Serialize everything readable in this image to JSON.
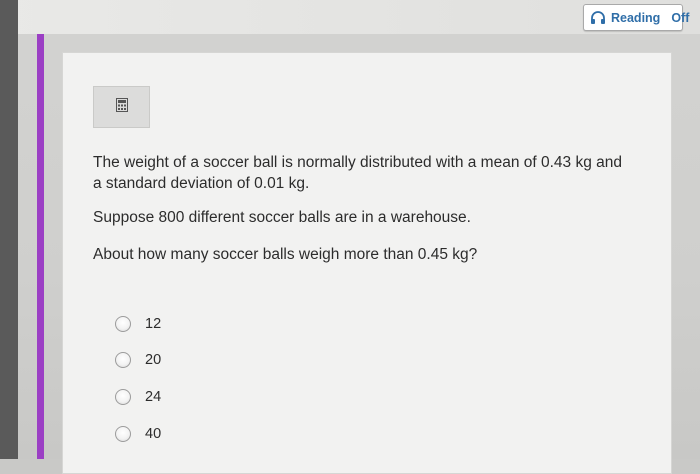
{
  "reading_toggle": {
    "label": "Reading",
    "state": "Off",
    "icon": "headphones-icon"
  },
  "calculator": {
    "icon": "calculator-icon"
  },
  "question": {
    "stem_line1": "The weight of a soccer ball is normally distributed with a mean of 0.43 kg and",
    "stem_line2": "a standard deviation of 0.01 kg.",
    "context": "Suppose 800 different soccer balls are in a warehouse.",
    "prompt": "About how many soccer balls weigh more than 0.45 kg?"
  },
  "options": [
    "12",
    "20",
    "24",
    "40"
  ],
  "colors": {
    "accent": "#9b3fc4",
    "link": "#2f6ea8"
  }
}
